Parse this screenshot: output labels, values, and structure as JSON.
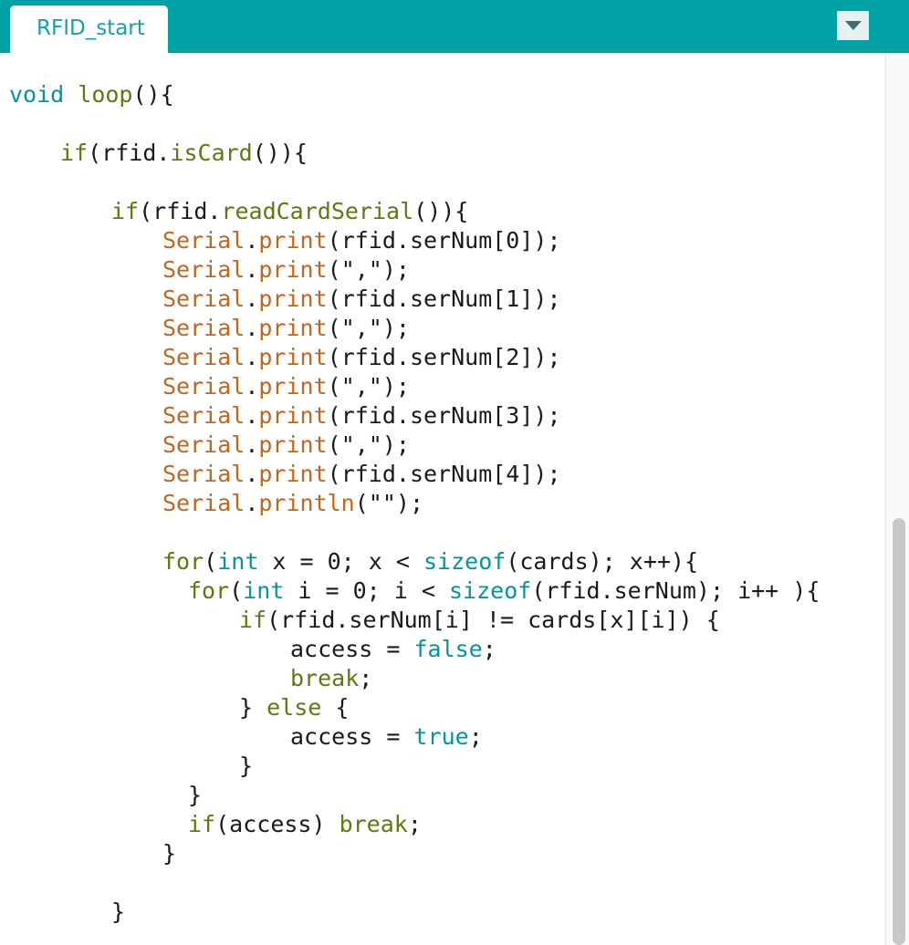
{
  "tabs": [
    {
      "label": "RFID_start"
    }
  ],
  "toolbar": {
    "menu_icon": "chevron-down-icon"
  },
  "colors": {
    "tabbar": "#00a1a4",
    "tab_text": "#17a1a5",
    "keyword": "#5b7b0e",
    "type": "#00979c",
    "class": "#c5651b",
    "default_text": "#1a1a1a"
  },
  "code": {
    "lines": [
      {
        "indent": 0,
        "tokens": [
          {
            "t": "void",
            "c": "ty"
          },
          {
            "t": " "
          },
          {
            "t": "loop",
            "c": "kw"
          },
          {
            "t": "(){"
          }
        ]
      },
      {
        "indent": 0,
        "tokens": []
      },
      {
        "indent": 4,
        "tokens": [
          {
            "t": "if",
            "c": "kw"
          },
          {
            "t": "(rfid."
          },
          {
            "t": "isCard",
            "c": "kw"
          },
          {
            "t": "()){"
          }
        ]
      },
      {
        "indent": 0,
        "tokens": []
      },
      {
        "indent": 8,
        "tokens": [
          {
            "t": "if",
            "c": "kw"
          },
          {
            "t": "(rfid."
          },
          {
            "t": "readCardSerial",
            "c": "kw"
          },
          {
            "t": "()){"
          }
        ]
      },
      {
        "indent": 12,
        "tokens": [
          {
            "t": "Serial",
            "c": "cls"
          },
          {
            "t": "."
          },
          {
            "t": "print",
            "c": "cls"
          },
          {
            "t": "(rfid.serNum[0]);"
          }
        ]
      },
      {
        "indent": 12,
        "tokens": [
          {
            "t": "Serial",
            "c": "cls"
          },
          {
            "t": "."
          },
          {
            "t": "print",
            "c": "cls"
          },
          {
            "t": "(\",\");"
          }
        ]
      },
      {
        "indent": 12,
        "tokens": [
          {
            "t": "Serial",
            "c": "cls"
          },
          {
            "t": "."
          },
          {
            "t": "print",
            "c": "cls"
          },
          {
            "t": "(rfid.serNum[1]);"
          }
        ]
      },
      {
        "indent": 12,
        "tokens": [
          {
            "t": "Serial",
            "c": "cls"
          },
          {
            "t": "."
          },
          {
            "t": "print",
            "c": "cls"
          },
          {
            "t": "(\",\");"
          }
        ]
      },
      {
        "indent": 12,
        "tokens": [
          {
            "t": "Serial",
            "c": "cls"
          },
          {
            "t": "."
          },
          {
            "t": "print",
            "c": "cls"
          },
          {
            "t": "(rfid.serNum[2]);"
          }
        ]
      },
      {
        "indent": 12,
        "tokens": [
          {
            "t": "Serial",
            "c": "cls"
          },
          {
            "t": "."
          },
          {
            "t": "print",
            "c": "cls"
          },
          {
            "t": "(\",\");"
          }
        ]
      },
      {
        "indent": 12,
        "tokens": [
          {
            "t": "Serial",
            "c": "cls"
          },
          {
            "t": "."
          },
          {
            "t": "print",
            "c": "cls"
          },
          {
            "t": "(rfid.serNum[3]);"
          }
        ]
      },
      {
        "indent": 12,
        "tokens": [
          {
            "t": "Serial",
            "c": "cls"
          },
          {
            "t": "."
          },
          {
            "t": "print",
            "c": "cls"
          },
          {
            "t": "(\",\");"
          }
        ]
      },
      {
        "indent": 12,
        "tokens": [
          {
            "t": "Serial",
            "c": "cls"
          },
          {
            "t": "."
          },
          {
            "t": "print",
            "c": "cls"
          },
          {
            "t": "(rfid.serNum[4]);"
          }
        ]
      },
      {
        "indent": 12,
        "tokens": [
          {
            "t": "Serial",
            "c": "cls"
          },
          {
            "t": "."
          },
          {
            "t": "println",
            "c": "cls"
          },
          {
            "t": "(\"\");"
          }
        ]
      },
      {
        "indent": 0,
        "tokens": []
      },
      {
        "indent": 12,
        "tokens": [
          {
            "t": "for",
            "c": "kw"
          },
          {
            "t": "("
          },
          {
            "t": "int",
            "c": "ty"
          },
          {
            "t": " x = 0; x < "
          },
          {
            "t": "sizeof",
            "c": "ty"
          },
          {
            "t": "(cards); x++){"
          }
        ]
      },
      {
        "indent": 14,
        "tokens": [
          {
            "t": "for",
            "c": "kw"
          },
          {
            "t": "("
          },
          {
            "t": "int",
            "c": "ty"
          },
          {
            "t": " i = 0; i < "
          },
          {
            "t": "sizeof",
            "c": "ty"
          },
          {
            "t": "(rfid.serNum); i++ ){"
          }
        ]
      },
      {
        "indent": 18,
        "tokens": [
          {
            "t": "if",
            "c": "kw"
          },
          {
            "t": "(rfid.serNum[i] != cards[x][i]) {"
          }
        ]
      },
      {
        "indent": 22,
        "tokens": [
          {
            "t": "access = "
          },
          {
            "t": "false",
            "c": "ty"
          },
          {
            "t": ";"
          }
        ]
      },
      {
        "indent": 22,
        "tokens": [
          {
            "t": "break",
            "c": "kw"
          },
          {
            "t": ";"
          }
        ]
      },
      {
        "indent": 18,
        "tokens": [
          {
            "t": "} "
          },
          {
            "t": "else",
            "c": "kw"
          },
          {
            "t": " {"
          }
        ]
      },
      {
        "indent": 22,
        "tokens": [
          {
            "t": "access = "
          },
          {
            "t": "true",
            "c": "ty"
          },
          {
            "t": ";"
          }
        ]
      },
      {
        "indent": 18,
        "tokens": [
          {
            "t": "}"
          }
        ]
      },
      {
        "indent": 14,
        "tokens": [
          {
            "t": "}"
          }
        ]
      },
      {
        "indent": 14,
        "tokens": [
          {
            "t": "if",
            "c": "kw"
          },
          {
            "t": "(access) "
          },
          {
            "t": "break",
            "c": "kw"
          },
          {
            "t": ";"
          }
        ]
      },
      {
        "indent": 12,
        "tokens": [
          {
            "t": "}"
          }
        ]
      },
      {
        "indent": 0,
        "tokens": []
      },
      {
        "indent": 8,
        "tokens": [
          {
            "t": "}"
          }
        ]
      }
    ]
  }
}
